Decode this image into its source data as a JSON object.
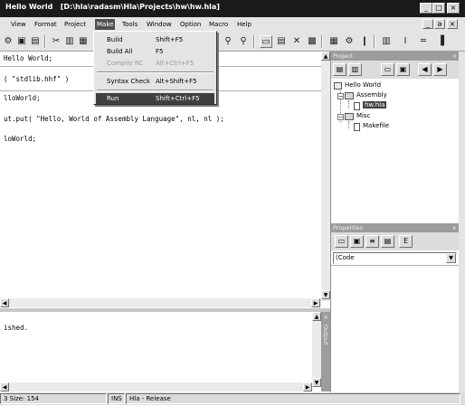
{
  "window": {
    "title": "Hello World",
    "path": "[D:\\hla\\radasm\\Hla\\Projects\\hw\\hw.hla]",
    "controls": [
      "_",
      "□",
      "×"
    ],
    "doc_controls": [
      "_",
      "ə",
      "×"
    ]
  },
  "menubar": {
    "items": [
      "View",
      "Format",
      "Project",
      "Make",
      "Tools",
      "Window",
      "Option",
      "Macro",
      "Help"
    ],
    "active": "Make"
  },
  "make_menu": {
    "items": [
      {
        "label": "Build",
        "shortcut": "Shift+F5",
        "state": "normal"
      },
      {
        "label": "Build All",
        "shortcut": "F5",
        "state": "normal"
      },
      {
        "label": "Compile RC",
        "shortcut": "Alt+Ctrl+F5",
        "state": "disabled"
      },
      {
        "label": "Syntax Check",
        "shortcut": "Alt+Shift+F5",
        "state": "normal"
      },
      {
        "label": "Run",
        "shortcut": "Shift+Ctrl+F5",
        "state": "selected"
      }
    ]
  },
  "editor": {
    "lines": [
      "Hello World;",
      "( \"stdlib.hhf\" )",
      "lloWorld;",
      "ut.put( \"Hello, World of Assembly Language\", nl, nl );",
      "loWorld;"
    ]
  },
  "output": {
    "side_label": "Output",
    "lines": [
      "ished."
    ]
  },
  "project_panel": {
    "caption": "Project",
    "tree": {
      "root": "Hello World",
      "groups": [
        {
          "name": "Assembly",
          "files": [
            "hw.hla"
          ]
        },
        {
          "name": "Misc",
          "files": [
            "Makefile"
          ]
        }
      ]
    }
  },
  "properties_panel": {
    "caption": "Properties",
    "dropdown_value": "(Code"
  },
  "statusbar": {
    "size": "3 Size: 154",
    "ins": "INS",
    "build": "Hla - Release"
  }
}
